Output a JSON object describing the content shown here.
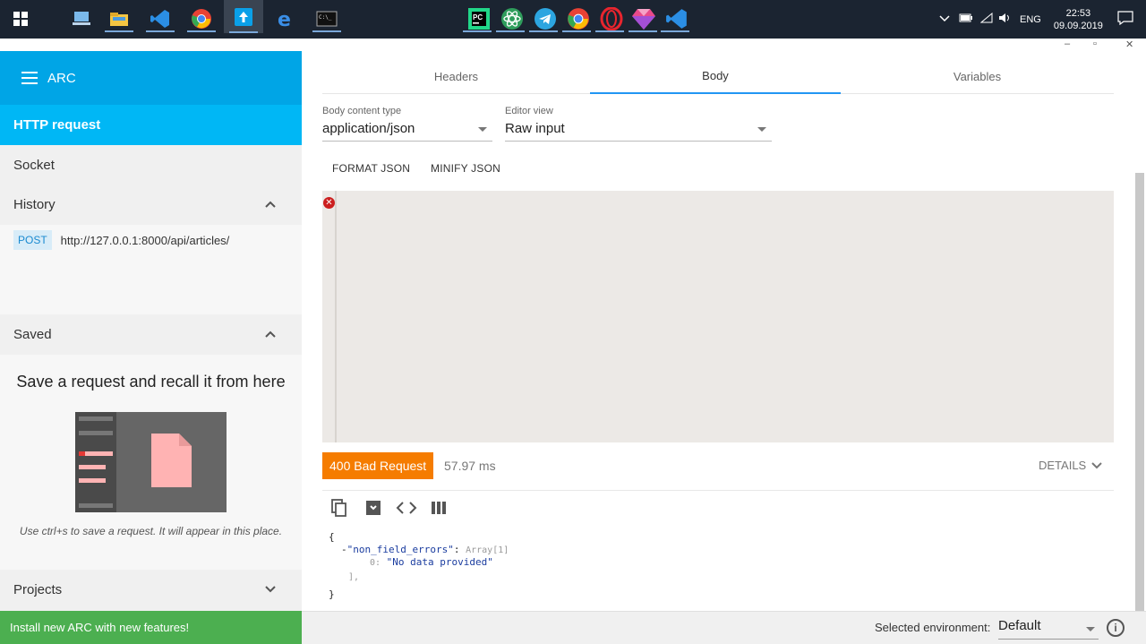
{
  "taskbar": {
    "icons": [
      "windows-start",
      "computer",
      "file-explorer",
      "vscode",
      "chrome",
      "arc",
      "edge",
      "terminal",
      "pycharm",
      "atom",
      "telegram",
      "chrome",
      "opera",
      "app",
      "vscode"
    ],
    "tray": {
      "lang": "ENG",
      "time": "22:53",
      "date": "09.09.2019"
    }
  },
  "window": {
    "minimize": "–",
    "restore": "▫",
    "close": "✕"
  },
  "sidebar": {
    "title": "ARC",
    "http_request": "HTTP request",
    "socket": "Socket",
    "history": {
      "label": "History",
      "items": [
        {
          "method": "POST",
          "url": "http://127.0.0.1:8000/api/articles/"
        }
      ]
    },
    "saved": {
      "label": "Saved",
      "empty_title": "Save a request and recall it from here",
      "hint": "Use ctrl+s to save a request. It will appear in this place."
    },
    "projects": "Projects",
    "install_banner": "Install new ARC with new features!"
  },
  "tabs": [
    {
      "label": "Headers",
      "active": false
    },
    {
      "label": "Body",
      "active": true
    },
    {
      "label": "Variables",
      "active": false
    }
  ],
  "body": {
    "content_type_label": "Body content type",
    "content_type_value": "application/json",
    "editor_view_label": "Editor view",
    "editor_view_value": "Raw input",
    "format_json": "FORMAT JSON",
    "minify_json": "MINIFY JSON",
    "editor_content": ""
  },
  "response": {
    "status": "400 Bad Request",
    "time": "57.97 ms",
    "details": "DETAILS",
    "json": {
      "open": "{",
      "toggle": "-",
      "key": "\"non_field_errors\"",
      "colon": ":",
      "type": "Array[1]",
      "index": "0:",
      "value": "\"No data provided\"",
      "array_close": "],",
      "close": "}"
    }
  },
  "footer": {
    "env_label": "Selected environment:",
    "env_value": "Default",
    "info": "i"
  },
  "colors": {
    "header": "#00a5e6",
    "active_nav": "#00b7f5",
    "status_error": "#f57c00",
    "install": "#4caf50",
    "tab_indicator": "#2196f3"
  }
}
